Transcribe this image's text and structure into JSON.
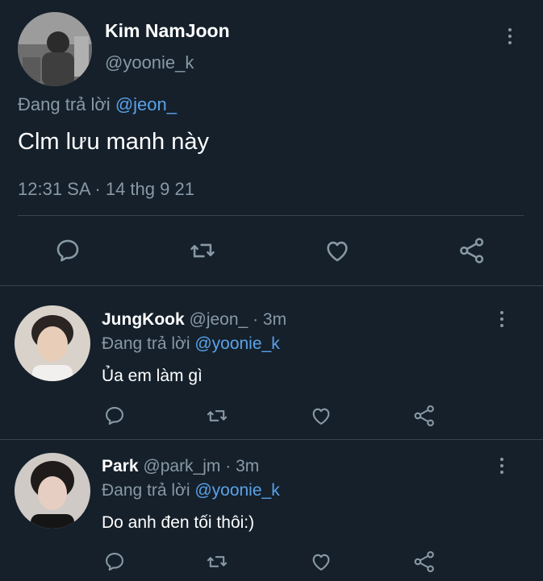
{
  "main_tweet": {
    "author_name": "Kim NamJoon",
    "author_handle": "@yoonie_k",
    "replying_to_prefix": "Đang trả lời",
    "replying_to_handle": "@jeon_",
    "text": "Clm lưu manh này",
    "timestamp": "12:31 SA · 14 thg 9 21"
  },
  "replies": [
    {
      "name": "JungKook",
      "handle": "@jeon_",
      "time": "· 3m",
      "replying_to_prefix": "Đang trả lời",
      "replying_to_handle": "@yoonie_k",
      "text": "Ủa em làm gì"
    },
    {
      "name": "Park",
      "handle": "@park_jm",
      "time": "· 3m",
      "replying_to_prefix": "Đang trả lời",
      "replying_to_handle": "@yoonie_k",
      "text": "Do anh đen tối thôi:)"
    }
  ],
  "icons": {
    "reply": "reply-icon",
    "retweet": "retweet-icon",
    "like": "heart-icon",
    "share": "share-icon",
    "more": "more-vertical-icon"
  },
  "colors": {
    "background": "#15202b",
    "muted_text": "#8899a6",
    "link": "#5aa2e8",
    "divider": "#38444d"
  }
}
